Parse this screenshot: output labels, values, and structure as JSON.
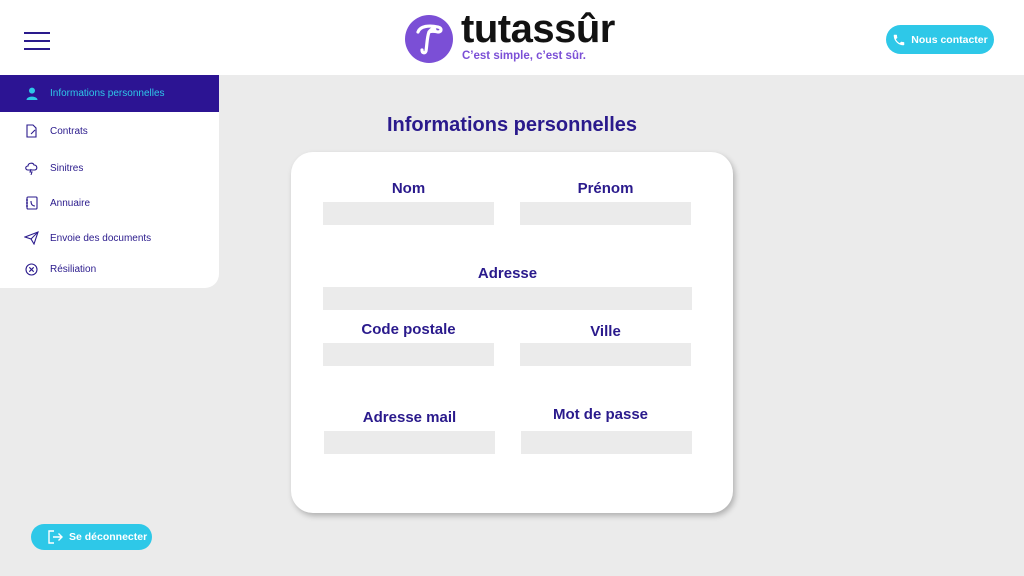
{
  "header": {
    "brand_name": "tutassûr",
    "tagline": "C’est simple, c’est sûr.",
    "contact_label": "Nous contacter"
  },
  "sidebar": {
    "items": [
      {
        "label": "Informations personnelles",
        "icon": "user-icon",
        "active": true
      },
      {
        "label": "Contrats",
        "icon": "contract-icon"
      },
      {
        "label": "Sinitres",
        "icon": "cloud-icon"
      },
      {
        "label": "Annuaire",
        "icon": "directory-icon"
      },
      {
        "label": "Envoie des documents",
        "icon": "send-icon"
      },
      {
        "label": "Résiliation",
        "icon": "cancel-icon"
      }
    ]
  },
  "main": {
    "title": "Informations personnelles",
    "fields": {
      "nom": {
        "label": "Nom",
        "value": ""
      },
      "prenom": {
        "label": "Prénom",
        "value": ""
      },
      "adresse": {
        "label": "Adresse",
        "value": ""
      },
      "code_postale": {
        "label": "Code postale",
        "value": ""
      },
      "ville": {
        "label": "Ville",
        "value": ""
      },
      "adresse_mail": {
        "label": "Adresse mail",
        "value": ""
      },
      "mot_de_passe": {
        "label": "Mot de passe",
        "value": ""
      }
    }
  },
  "footer": {
    "logout_label": "Se déconnecter"
  },
  "colors": {
    "primary": "#2a1a8c",
    "active_bg": "#2c1493",
    "accent": "#2ec8e8",
    "logo_purple": "#7b4fd6",
    "background": "#ebebeb"
  }
}
